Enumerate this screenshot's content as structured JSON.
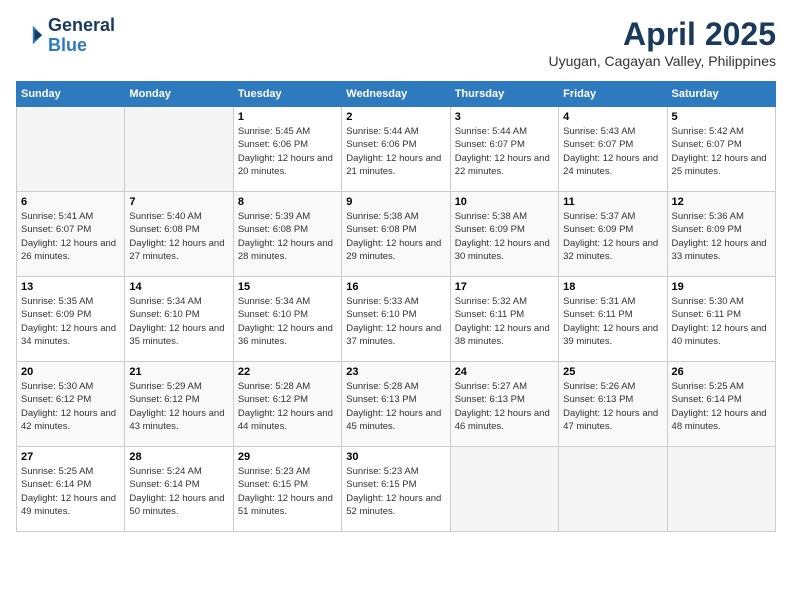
{
  "header": {
    "logo_line1": "General",
    "logo_line2": "Blue",
    "month": "April 2025",
    "location": "Uyugan, Cagayan Valley, Philippines"
  },
  "days_of_week": [
    "Sunday",
    "Monday",
    "Tuesday",
    "Wednesday",
    "Thursday",
    "Friday",
    "Saturday"
  ],
  "weeks": [
    [
      {
        "day": "",
        "info": ""
      },
      {
        "day": "",
        "info": ""
      },
      {
        "day": "1",
        "info": "Sunrise: 5:45 AM\nSunset: 6:06 PM\nDaylight: 12 hours and 20 minutes."
      },
      {
        "day": "2",
        "info": "Sunrise: 5:44 AM\nSunset: 6:06 PM\nDaylight: 12 hours and 21 minutes."
      },
      {
        "day": "3",
        "info": "Sunrise: 5:44 AM\nSunset: 6:07 PM\nDaylight: 12 hours and 22 minutes."
      },
      {
        "day": "4",
        "info": "Sunrise: 5:43 AM\nSunset: 6:07 PM\nDaylight: 12 hours and 24 minutes."
      },
      {
        "day": "5",
        "info": "Sunrise: 5:42 AM\nSunset: 6:07 PM\nDaylight: 12 hours and 25 minutes."
      }
    ],
    [
      {
        "day": "6",
        "info": "Sunrise: 5:41 AM\nSunset: 6:07 PM\nDaylight: 12 hours and 26 minutes."
      },
      {
        "day": "7",
        "info": "Sunrise: 5:40 AM\nSunset: 6:08 PM\nDaylight: 12 hours and 27 minutes."
      },
      {
        "day": "8",
        "info": "Sunrise: 5:39 AM\nSunset: 6:08 PM\nDaylight: 12 hours and 28 minutes."
      },
      {
        "day": "9",
        "info": "Sunrise: 5:38 AM\nSunset: 6:08 PM\nDaylight: 12 hours and 29 minutes."
      },
      {
        "day": "10",
        "info": "Sunrise: 5:38 AM\nSunset: 6:09 PM\nDaylight: 12 hours and 30 minutes."
      },
      {
        "day": "11",
        "info": "Sunrise: 5:37 AM\nSunset: 6:09 PM\nDaylight: 12 hours and 32 minutes."
      },
      {
        "day": "12",
        "info": "Sunrise: 5:36 AM\nSunset: 6:09 PM\nDaylight: 12 hours and 33 minutes."
      }
    ],
    [
      {
        "day": "13",
        "info": "Sunrise: 5:35 AM\nSunset: 6:09 PM\nDaylight: 12 hours and 34 minutes."
      },
      {
        "day": "14",
        "info": "Sunrise: 5:34 AM\nSunset: 6:10 PM\nDaylight: 12 hours and 35 minutes."
      },
      {
        "day": "15",
        "info": "Sunrise: 5:34 AM\nSunset: 6:10 PM\nDaylight: 12 hours and 36 minutes."
      },
      {
        "day": "16",
        "info": "Sunrise: 5:33 AM\nSunset: 6:10 PM\nDaylight: 12 hours and 37 minutes."
      },
      {
        "day": "17",
        "info": "Sunrise: 5:32 AM\nSunset: 6:11 PM\nDaylight: 12 hours and 38 minutes."
      },
      {
        "day": "18",
        "info": "Sunrise: 5:31 AM\nSunset: 6:11 PM\nDaylight: 12 hours and 39 minutes."
      },
      {
        "day": "19",
        "info": "Sunrise: 5:30 AM\nSunset: 6:11 PM\nDaylight: 12 hours and 40 minutes."
      }
    ],
    [
      {
        "day": "20",
        "info": "Sunrise: 5:30 AM\nSunset: 6:12 PM\nDaylight: 12 hours and 42 minutes."
      },
      {
        "day": "21",
        "info": "Sunrise: 5:29 AM\nSunset: 6:12 PM\nDaylight: 12 hours and 43 minutes."
      },
      {
        "day": "22",
        "info": "Sunrise: 5:28 AM\nSunset: 6:12 PM\nDaylight: 12 hours and 44 minutes."
      },
      {
        "day": "23",
        "info": "Sunrise: 5:28 AM\nSunset: 6:13 PM\nDaylight: 12 hours and 45 minutes."
      },
      {
        "day": "24",
        "info": "Sunrise: 5:27 AM\nSunset: 6:13 PM\nDaylight: 12 hours and 46 minutes."
      },
      {
        "day": "25",
        "info": "Sunrise: 5:26 AM\nSunset: 6:13 PM\nDaylight: 12 hours and 47 minutes."
      },
      {
        "day": "26",
        "info": "Sunrise: 5:25 AM\nSunset: 6:14 PM\nDaylight: 12 hours and 48 minutes."
      }
    ],
    [
      {
        "day": "27",
        "info": "Sunrise: 5:25 AM\nSunset: 6:14 PM\nDaylight: 12 hours and 49 minutes."
      },
      {
        "day": "28",
        "info": "Sunrise: 5:24 AM\nSunset: 6:14 PM\nDaylight: 12 hours and 50 minutes."
      },
      {
        "day": "29",
        "info": "Sunrise: 5:23 AM\nSunset: 6:15 PM\nDaylight: 12 hours and 51 minutes."
      },
      {
        "day": "30",
        "info": "Sunrise: 5:23 AM\nSunset: 6:15 PM\nDaylight: 12 hours and 52 minutes."
      },
      {
        "day": "",
        "info": ""
      },
      {
        "day": "",
        "info": ""
      },
      {
        "day": "",
        "info": ""
      }
    ]
  ]
}
